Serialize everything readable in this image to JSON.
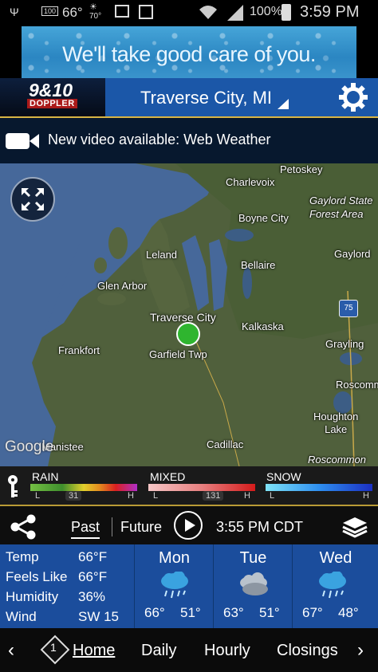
{
  "status_bar": {
    "temp": "66°",
    "weather_temp": "70°",
    "battery_percent": "100%",
    "time": "3:59 PM"
  },
  "ad": {
    "text": "We'll take good care of you."
  },
  "header": {
    "logo_number": "9&10",
    "logo_text": "DOPPLER",
    "location": "Traverse City, MI"
  },
  "video_bar": {
    "text": "New video available: Web Weather"
  },
  "map": {
    "labels": {
      "charlevoix": "Charlevoix",
      "petoskey": "Petoskey",
      "gaylord_forest": "Gaylord State\nForest Area",
      "boyne_city": "Boyne City",
      "leland": "Leland",
      "bellaire": "Bellaire",
      "gaylord": "Gaylord",
      "glen_arbor": "Glen Arbor",
      "traverse_city": "Traverse City",
      "kalkaska": "Kalkaska",
      "garfield": "Garfield Twp",
      "frankfort": "Frankfort",
      "grayling": "Grayling",
      "roscommon_top": "Roscomm",
      "houghton_lake": "Houghton\nLake",
      "manistee": "Manistee",
      "cadillac": "Cadillac",
      "roscommon_forest": "Roscommon\nState Forest",
      "i75": "75",
      "google": "Google"
    }
  },
  "legend": {
    "rain": "RAIN",
    "mixed": "MIXED",
    "snow": "SNOW",
    "low": "L",
    "high": "H",
    "road_31": "31",
    "road_131": "131"
  },
  "controls": {
    "past": "Past",
    "future": "Future",
    "time": "3:55 PM CDT"
  },
  "conditions": {
    "temp_label": "Temp",
    "temp_value": "66°F",
    "feels_label": "Feels Like",
    "feels_value": "66°F",
    "humidity_label": "Humidity",
    "humidity_value": "36%",
    "wind_label": "Wind",
    "wind_value": "SW 15"
  },
  "forecast": [
    {
      "day": "Mon",
      "hi": "66°",
      "lo": "51°",
      "icon": "rain-cloud-icon"
    },
    {
      "day": "Tue",
      "hi": "63°",
      "lo": "51°",
      "icon": "partly-cloudy-icon"
    },
    {
      "day": "Wed",
      "hi": "67°",
      "lo": "48°",
      "icon": "rain-cloud-icon"
    }
  ],
  "nav": {
    "badge": "1",
    "home": "Home",
    "daily": "Daily",
    "hourly": "Hourly",
    "closings": "Closings"
  },
  "colors": {
    "header_blue": "#1b57a8",
    "accent_gold": "#d9b545",
    "panel_blue": "#1b4d9c",
    "pin_green": "#2fb52f"
  }
}
